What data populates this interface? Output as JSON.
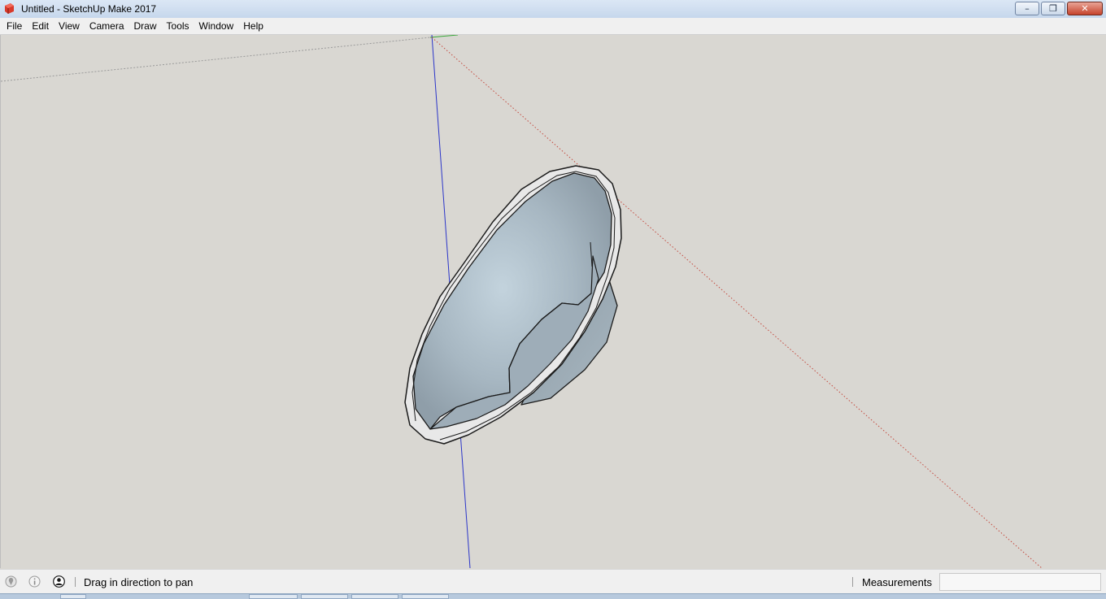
{
  "window": {
    "title": "Untitled - SketchUp Make 2017",
    "icon": "sketchup-logo-icon",
    "controls": {
      "minimize": "–",
      "maximize": "❐",
      "close": "✕"
    }
  },
  "menu": {
    "items": [
      "File",
      "Edit",
      "View",
      "Camera",
      "Draw",
      "Tools",
      "Window",
      "Help"
    ]
  },
  "viewport": {
    "model": "tapered ring solid",
    "colors": {
      "background": "#d9d7d2",
      "blue_axis": "#2b35c9",
      "red_axis": "#c44a3f",
      "green_axis": "#3aa83a",
      "face": "#a8b7c2",
      "edge": "#1a1a1a"
    }
  },
  "status": {
    "icons": [
      "geolocation-icon",
      "info-icon",
      "user-icon"
    ],
    "message": "Drag in direction to pan",
    "measurements_label": "Measurements",
    "measurements_value": ""
  }
}
